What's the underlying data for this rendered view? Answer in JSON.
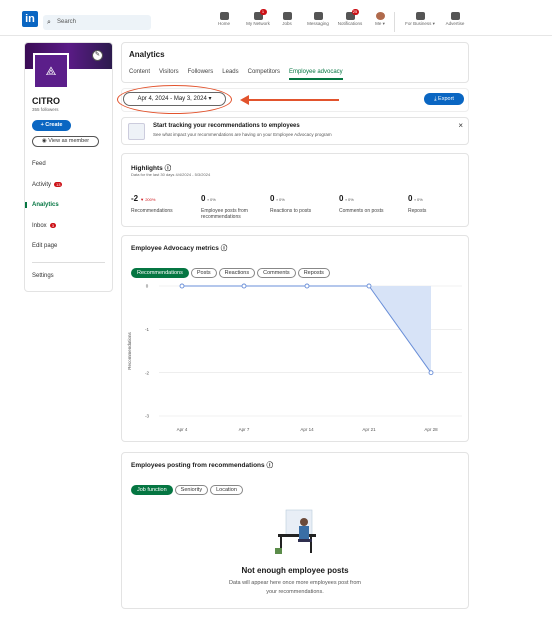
{
  "nav": {
    "logo": "in",
    "search_placeholder": "Search",
    "items": [
      {
        "label": "Home",
        "badge": ""
      },
      {
        "label": "My Network",
        "badge": "1"
      },
      {
        "label": "Jobs",
        "badge": ""
      },
      {
        "label": "Messaging",
        "badge": ""
      },
      {
        "label": "Notifications",
        "badge": "25"
      },
      {
        "label": "Me ▾",
        "badge": ""
      },
      {
        "label": "For Business ▾",
        "badge": ""
      },
      {
        "label": "Advertise",
        "badge": ""
      }
    ]
  },
  "sidebar": {
    "org_name": "CITRO",
    "followers": "355 followers",
    "create_label": "+ Create",
    "view_as_member_label": "View as member",
    "items": [
      {
        "label": "Feed",
        "count": ""
      },
      {
        "label": "Activity",
        "count": "13"
      },
      {
        "label": "Analytics",
        "count": ""
      },
      {
        "label": "Inbox",
        "count": "3"
      },
      {
        "label": "Edit page",
        "count": ""
      },
      {
        "label": "Settings",
        "count": ""
      }
    ]
  },
  "analytics": {
    "title": "Analytics",
    "tabs": [
      "Content",
      "Visitors",
      "Followers",
      "Leads",
      "Competitors",
      "Employee advocacy"
    ],
    "active_tab": "Employee advocacy"
  },
  "filter": {
    "date_range": "Apr 4, 2024 - May 3, 2024 ▾",
    "export_label": "Export"
  },
  "banner": {
    "title": "Start tracking your recommendations to employees",
    "subtitle": "See what impact your recommendations are having on your Employee Advocacy program"
  },
  "highlights": {
    "title": "Highlights",
    "subtitle": "Data for the last 30 days 4/4/2024 - 5/3/2024",
    "stats": [
      {
        "value": "-2",
        "delta": "▼ 200%",
        "delta_color": "#cc1016",
        "label": "Recommendations"
      },
      {
        "value": "0",
        "delta": "▪ 0%",
        "delta_color": "#555555",
        "label": "Employee posts from recommendations"
      },
      {
        "value": "0",
        "delta": "▪ 0%",
        "delta_color": "#555555",
        "label": "Reactions to posts"
      },
      {
        "value": "0",
        "delta": "▪ 0%",
        "delta_color": "#555555",
        "label": "Comments on posts"
      },
      {
        "value": "0",
        "delta": "▪ 0%",
        "delta_color": "#555555",
        "label": "Reposts"
      }
    ]
  },
  "metrics": {
    "title": "Employee Advocacy metrics",
    "pills": [
      "Recommendations",
      "Posts",
      "Reactions",
      "Comments",
      "Reposts"
    ],
    "active_pill": "Recommendations"
  },
  "chart_data": {
    "type": "area",
    "ylabel": "Recommendations",
    "x": [
      "Apr 4",
      "Apr 7",
      "Apr 14",
      "Apr 21",
      "Apr 28"
    ],
    "values": [
      0,
      0,
      0,
      0,
      -2
    ],
    "yticks": [
      0,
      -1,
      -2,
      -3
    ],
    "ylim": [
      -3,
      0
    ],
    "series_color": "#6a8fd8",
    "fill_color": "#d7e3f7",
    "grid": true
  },
  "employees": {
    "title": "Employees posting from recommendations",
    "pills": [
      "Job function",
      "Seniority",
      "Location"
    ],
    "active_pill": "Job function",
    "empty_title": "Not enough employee posts",
    "empty_text": "Data will appear here once more employees post from your recommendations."
  }
}
